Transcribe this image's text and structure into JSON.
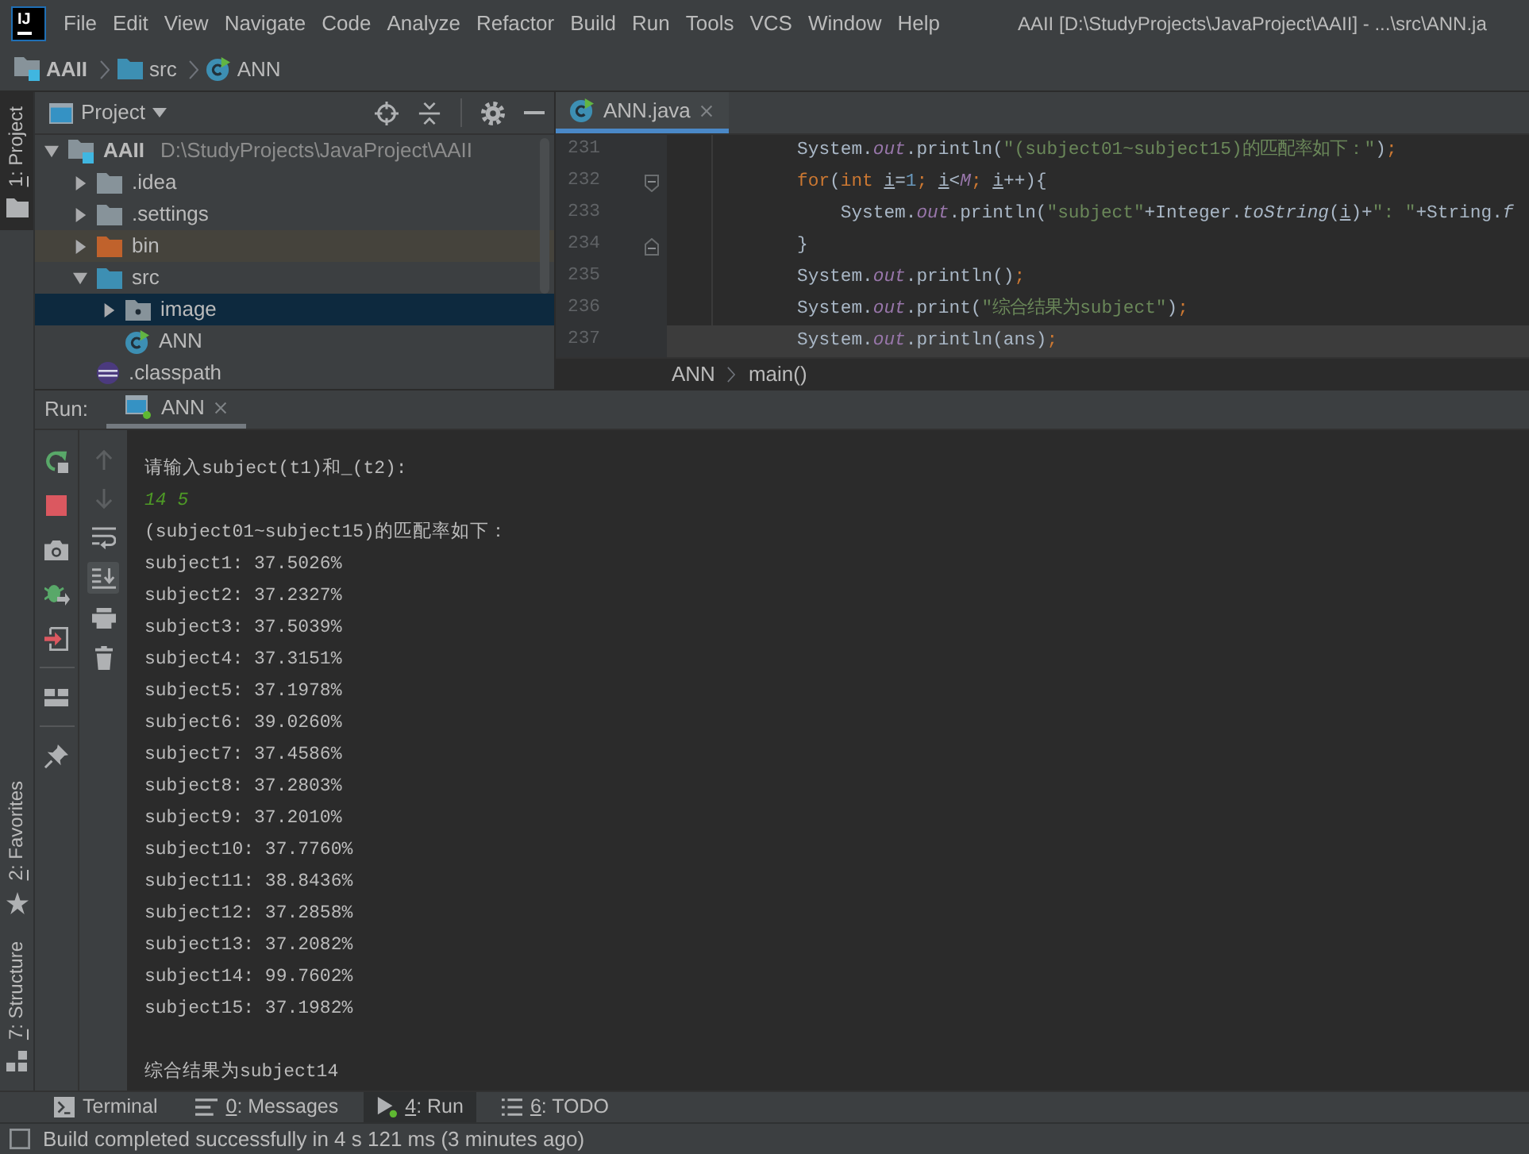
{
  "window": {
    "logo": "IJ",
    "title": "AAII [D:\\StudyProjects\\JavaProject\\AAII] - ...\\src\\ANN.ja"
  },
  "menu": [
    "File",
    "Edit",
    "View",
    "Navigate",
    "Code",
    "Analyze",
    "Refactor",
    "Build",
    "Run",
    "Tools",
    "VCS",
    "Window",
    "Help"
  ],
  "navigation_bar": [
    {
      "label": "AAII",
      "kind": "module"
    },
    {
      "label": "src",
      "kind": "source"
    },
    {
      "label": "ANN",
      "kind": "class"
    }
  ],
  "tool_strip": [
    {
      "label": "1: Project",
      "kind": "project",
      "selected": true,
      "mnemonic": true
    },
    {
      "label": "2: Favorites",
      "kind": "favorites",
      "selected": false,
      "mnemonic": true
    },
    {
      "label": "7: Structure",
      "kind": "structure",
      "selected": false,
      "mnemonic": true
    }
  ],
  "project_panel": {
    "title": "Project",
    "tree": [
      {
        "label": "AAII",
        "path": "D:\\StudyProjects\\JavaProject\\AAII",
        "kind": "module",
        "expanded": true,
        "selected": false,
        "children": [
          {
            "label": ".idea",
            "kind": "folder",
            "expanded": false,
            "selected": false
          },
          {
            "label": ".settings",
            "kind": "folder",
            "expanded": false,
            "selected": false
          },
          {
            "label": "bin",
            "kind": "excluded",
            "expanded": false,
            "selected": false
          },
          {
            "label": "src",
            "kind": "source",
            "expanded": true,
            "selected": false,
            "children": [
              {
                "label": "image",
                "kind": "package",
                "expanded": false,
                "selected": true
              },
              {
                "label": "ANN",
                "kind": "class",
                "selected": false
              }
            ]
          },
          {
            "label": ".classpath",
            "kind": "file",
            "selected": false
          }
        ]
      }
    ]
  },
  "editor": {
    "tabs": [
      {
        "label": "ANN.java",
        "selected": true
      }
    ],
    "lines": [
      {
        "number": "231",
        "current": false,
        "tokens": [
          {
            "text": "            System.",
            "kind": "plain"
          },
          {
            "text": "out",
            "kind": "field"
          },
          {
            "text": ".println(",
            "kind": "plain"
          },
          {
            "text": "\"(subject01~subject15)的匹配率如下：\"",
            "kind": "string"
          },
          {
            "text": ")",
            "kind": "plain"
          },
          {
            "text": ";",
            "kind": "punct"
          }
        ]
      },
      {
        "number": "232",
        "current": false,
        "fold_start": true,
        "tokens": [
          {
            "text": "            for",
            "kind": "keyword"
          },
          {
            "text": "(",
            "kind": "plain"
          },
          {
            "text": "int ",
            "kind": "keyword"
          },
          {
            "text": "i",
            "kind": "var"
          },
          {
            "text": "=",
            "kind": "plain"
          },
          {
            "text": "1",
            "kind": "number"
          },
          {
            "text": "; ",
            "kind": "punct"
          },
          {
            "text": "i",
            "kind": "var"
          },
          {
            "text": "<",
            "kind": "plain"
          },
          {
            "text": "M",
            "kind": "constant"
          },
          {
            "text": "; ",
            "kind": "punct"
          },
          {
            "text": "i",
            "kind": "var"
          },
          {
            "text": "++){",
            "kind": "plain"
          }
        ]
      },
      {
        "number": "233",
        "current": false,
        "tokens": [
          {
            "text": "                System.",
            "kind": "plain"
          },
          {
            "text": "out",
            "kind": "field"
          },
          {
            "text": ".println(",
            "kind": "plain"
          },
          {
            "text": "\"subject\"",
            "kind": "string"
          },
          {
            "text": "+Integer.",
            "kind": "plain"
          },
          {
            "text": "toString",
            "kind": "static"
          },
          {
            "text": "(",
            "kind": "plain"
          },
          {
            "text": "i",
            "kind": "var"
          },
          {
            "text": ")+",
            "kind": "plain"
          },
          {
            "text": "\": \"",
            "kind": "string"
          },
          {
            "text": "+String.",
            "kind": "plain"
          },
          {
            "text": "f",
            "kind": "static"
          }
        ]
      },
      {
        "number": "234",
        "current": false,
        "fold_end": true,
        "tokens": [
          {
            "text": "            }",
            "kind": "plain"
          }
        ]
      },
      {
        "number": "235",
        "current": false,
        "tokens": [
          {
            "text": "            System.",
            "kind": "plain"
          },
          {
            "text": "out",
            "kind": "field"
          },
          {
            "text": ".println()",
            "kind": "plain"
          },
          {
            "text": ";",
            "kind": "punct"
          }
        ]
      },
      {
        "number": "236",
        "current": false,
        "tokens": [
          {
            "text": "            System.",
            "kind": "plain"
          },
          {
            "text": "out",
            "kind": "field"
          },
          {
            "text": ".print(",
            "kind": "plain"
          },
          {
            "text": "\"综合结果为subject\"",
            "kind": "string"
          },
          {
            "text": ")",
            "kind": "plain"
          },
          {
            "text": ";",
            "kind": "punct"
          }
        ]
      },
      {
        "number": "237",
        "current": true,
        "tokens": [
          {
            "text": "            System.",
            "kind": "plain"
          },
          {
            "text": "out",
            "kind": "field"
          },
          {
            "text": ".println(ans)",
            "kind": "plain"
          },
          {
            "text": ";",
            "kind": "punct"
          }
        ]
      }
    ],
    "breadcrumb": [
      "ANN",
      "main()"
    ]
  },
  "run_panel": {
    "label": "Run:",
    "tabs": [
      {
        "label": "ANN",
        "selected": true
      }
    ],
    "actions": [
      {
        "kind": "rerun"
      },
      {
        "kind": "stop"
      },
      {
        "kind": "dump"
      },
      {
        "kind": "debug"
      },
      {
        "kind": "exit"
      },
      {
        "kind": "separator"
      },
      {
        "kind": "layout"
      },
      {
        "kind": "separator"
      },
      {
        "kind": "pin"
      }
    ],
    "console_actions": [
      {
        "kind": "up",
        "disabled": true,
        "selected": false
      },
      {
        "kind": "down",
        "disabled": true,
        "selected": false
      },
      {
        "kind": "wrap",
        "disabled": false,
        "selected": false
      },
      {
        "kind": "scroll",
        "disabled": false,
        "selected": true
      },
      {
        "kind": "print",
        "disabled": false,
        "selected": false
      },
      {
        "kind": "clear",
        "disabled": false,
        "selected": false
      }
    ],
    "console": [
      {
        "text": "请输入subject(t1)和_(t2):",
        "kind": "output"
      },
      {
        "text": "14 5",
        "kind": "input"
      },
      {
        "text": "(subject01~subject15)的匹配率如下：",
        "kind": "output"
      },
      {
        "text": "subject1: 37.5026%",
        "kind": "output"
      },
      {
        "text": "subject2: 37.2327%",
        "kind": "output"
      },
      {
        "text": "subject3: 37.5039%",
        "kind": "output"
      },
      {
        "text": "subject4: 37.3151%",
        "kind": "output"
      },
      {
        "text": "subject5: 37.1978%",
        "kind": "output"
      },
      {
        "text": "subject6: 39.0260%",
        "kind": "output"
      },
      {
        "text": "subject7: 37.4586%",
        "kind": "output"
      },
      {
        "text": "subject8: 37.2803%",
        "kind": "output"
      },
      {
        "text": "subject9: 37.2010%",
        "kind": "output"
      },
      {
        "text": "subject10: 37.7760%",
        "kind": "output"
      },
      {
        "text": "subject11: 38.8436%",
        "kind": "output"
      },
      {
        "text": "subject12: 37.2858%",
        "kind": "output"
      },
      {
        "text": "subject13: 37.2082%",
        "kind": "output"
      },
      {
        "text": "subject14: 99.7602%",
        "kind": "output"
      },
      {
        "text": "subject15: 37.1982%",
        "kind": "output"
      },
      {
        "kind": "blank"
      },
      {
        "text": "综合结果为subject14",
        "kind": "output"
      }
    ]
  },
  "tool_bar": [
    {
      "label": "Terminal",
      "kind": "terminal",
      "selected": false,
      "mnemonic": false
    },
    {
      "label": "0: Messages",
      "kind": "messages",
      "selected": false,
      "mnemonic": true
    },
    {
      "label": "4: Run",
      "kind": "run",
      "selected": true,
      "mnemonic": true
    },
    {
      "label": "6: TODO",
      "kind": "todo",
      "selected": false,
      "mnemonic": true
    }
  ],
  "status_bar": {
    "text": "Build completed successfully in 4 s 121 ms (3 minutes ago)"
  }
}
